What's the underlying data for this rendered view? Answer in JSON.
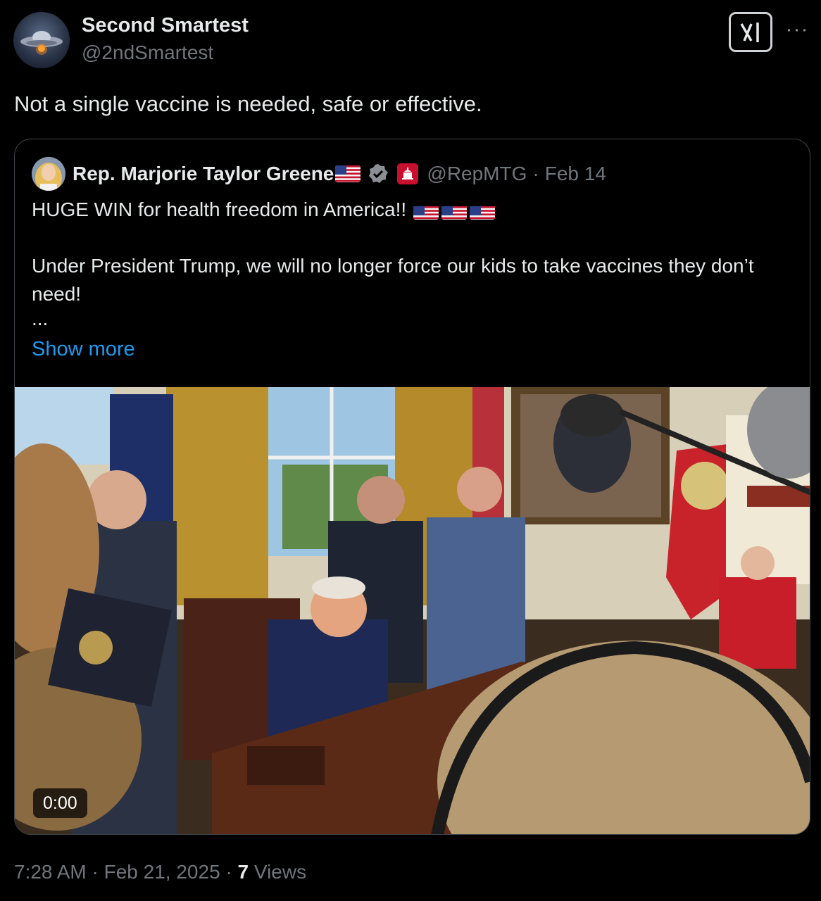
{
  "post": {
    "author_name": "Second Smartest",
    "author_handle": "@2ndSmartest",
    "text": "Not a single vaccine is needed, safe or effective.",
    "time": "7:28 AM",
    "separator": "·",
    "date": "Feb 21, 2025",
    "views_count": "7",
    "views_label": "Views"
  },
  "quote": {
    "author_name": "Rep. Marjorie Taylor Greene",
    "author_handle": "@RepMTG",
    "date": "Feb 14",
    "separator": "·",
    "line1": "HUGE WIN for health freedom in America!!",
    "line2": "Under President Trump, we will no longer force our kids to take vaccines they don’t need!",
    "ellipsis": "...",
    "show_more": "Show more",
    "video_time": "0:00"
  },
  "colors": {
    "background": "#000000",
    "text_primary": "#e7e9ea",
    "text_secondary": "#71767b",
    "link": "#1d9bf0",
    "border": "#3f4448"
  },
  "icons": [
    "grok-icon",
    "more-icon",
    "verified-badge-icon",
    "government-affiliation-icon",
    "us-flag-icon"
  ]
}
